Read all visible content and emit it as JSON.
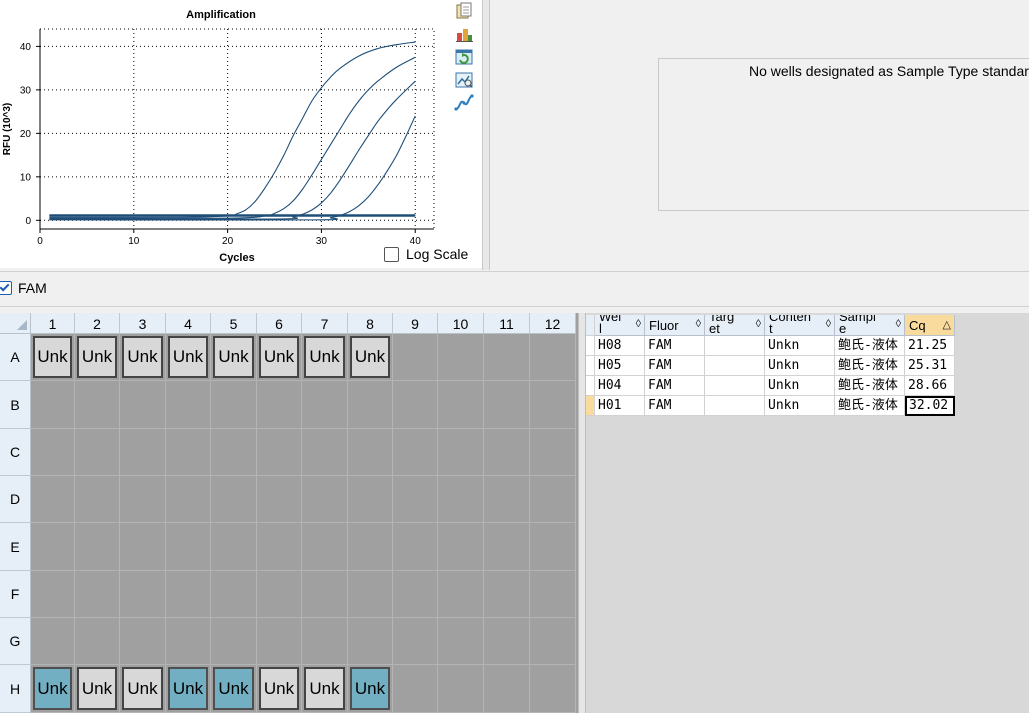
{
  "chart": {
    "title": "Amplification",
    "xlabel": "Cycles",
    "ylabel": "RFU (10^3)",
    "xticks": [
      "0",
      "10",
      "20",
      "30",
      "40"
    ],
    "yticks": [
      "0",
      "10",
      "20",
      "30",
      "40"
    ],
    "log_scale_label": "Log Scale",
    "curve_color": "#1f4e79"
  },
  "chart_data": {
    "type": "line",
    "title": "Amplification",
    "xlabel": "Cycles",
    "ylabel": "RFU (10^3)",
    "xlim": [
      0,
      42
    ],
    "ylim": [
      -2,
      44
    ],
    "grid": true,
    "series": [
      {
        "x": [
          1,
          15,
          20,
          21,
          22,
          23,
          24,
          25,
          26,
          27,
          28,
          29,
          30,
          31,
          32,
          34,
          36,
          38,
          40
        ],
        "y": [
          0.7,
          0.7,
          1.0,
          1.5,
          2.5,
          4.5,
          7.5,
          11,
          15,
          19.5,
          23.5,
          27.5,
          30.5,
          33,
          35,
          37.8,
          39.5,
          40.4,
          41
        ]
      },
      {
        "x": [
          1,
          20,
          24,
          25,
          26,
          27,
          28,
          29,
          30,
          31,
          32,
          33,
          34,
          35,
          36,
          38,
          40
        ],
        "y": [
          0.5,
          0.5,
          1.0,
          1.6,
          2.7,
          4.5,
          7.2,
          10.5,
          14,
          17.5,
          21,
          24.5,
          27.5,
          30,
          32,
          35.2,
          37.5
        ]
      },
      {
        "x": [
          1,
          25,
          27,
          28,
          29,
          30,
          31,
          32,
          33,
          34,
          35,
          36,
          37,
          38,
          40
        ],
        "y": [
          0.3,
          0.3,
          0.8,
          1.4,
          2.4,
          4.0,
          6.3,
          9.3,
          12.7,
          16.2,
          19.5,
          22.7,
          25.4,
          27.8,
          32
        ]
      },
      {
        "x": [
          1,
          29,
          31,
          32,
          33,
          34,
          35,
          36,
          37,
          38,
          39,
          40
        ],
        "y": [
          0.1,
          0.1,
          0.6,
          1.1,
          2.0,
          3.4,
          5.4,
          8.1,
          11.3,
          14.9,
          19.3,
          24
        ]
      },
      {
        "x": [
          1,
          40
        ],
        "y": [
          1.0,
          1.0
        ]
      },
      {
        "x": [
          1,
          40
        ],
        "y": [
          1.2,
          1.2
        ]
      }
    ]
  },
  "standard_curve": {
    "message": "No wells designated as Sample Type standard"
  },
  "fluor": {
    "label": "FAM",
    "checked": true
  },
  "plate": {
    "columns": [
      "1",
      "2",
      "3",
      "4",
      "5",
      "6",
      "7",
      "8",
      "9",
      "10",
      "11",
      "12"
    ],
    "rows": [
      "A",
      "B",
      "C",
      "D",
      "E",
      "F",
      "G",
      "H"
    ],
    "wells": {
      "A": [
        "Unk",
        "Unk",
        "Unk",
        "Unk",
        "Unk",
        "Unk",
        "Unk",
        "Unk",
        "",
        "",
        "",
        ""
      ],
      "H": [
        "Unk",
        "Unk",
        "Unk",
        "Unk",
        "Unk",
        "Unk",
        "Unk",
        "Unk",
        "",
        "",
        "",
        ""
      ]
    },
    "selected_wells": [
      "H1",
      "H4",
      "H5",
      "H8"
    ],
    "colors": {
      "selected": "#72afc3",
      "normal": "#d8d8d8",
      "empty": "#a0a0a0"
    }
  },
  "table": {
    "headers": [
      "Wel\nl",
      "Fluor",
      "Targ\net",
      "Conten\nt",
      "Sampl\ne",
      "Cq"
    ],
    "sort_glyph": "◊",
    "sorted_glyph": "△",
    "rows": [
      [
        "H08",
        "FAM",
        "",
        "Unkn",
        "鲍氏-液体",
        "21.25"
      ],
      [
        "H05",
        "FAM",
        "",
        "Unkn",
        "鲍氏-液体",
        "25.31"
      ],
      [
        "H04",
        "FAM",
        "",
        "Unkn",
        "鲍氏-液体",
        "28.66"
      ],
      [
        "H01",
        "FAM",
        "",
        "Unkn",
        "鲍氏-液体",
        "32.02"
      ]
    ],
    "active_header": "Cq",
    "current_row": 3
  },
  "toolbar": {
    "icons": [
      "copy-icon",
      "export-icon",
      "refresh-icon",
      "image-icon",
      "line-chart-icon"
    ]
  }
}
